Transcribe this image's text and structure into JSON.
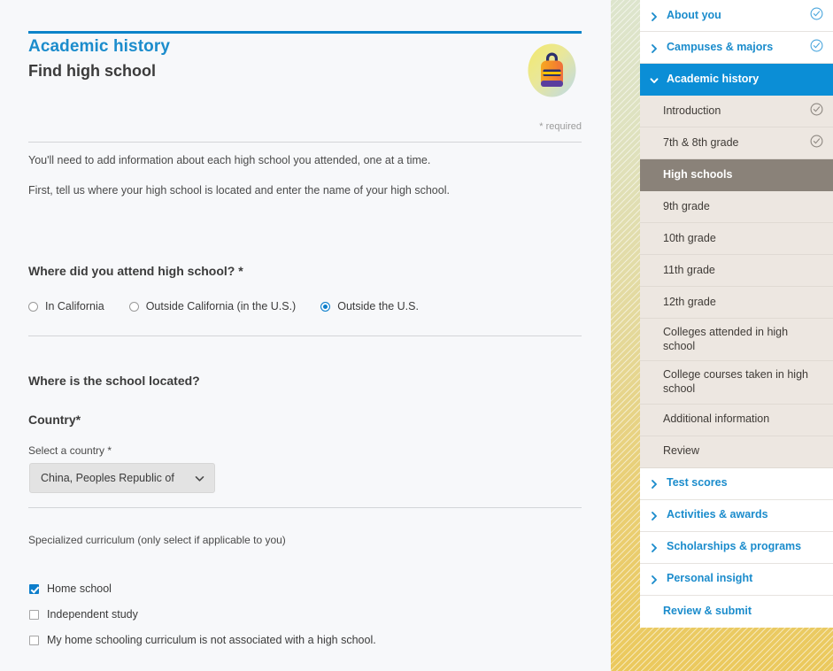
{
  "theme": {
    "accent_blue": "#0b83c9",
    "nav_active_blue": "#0b8ed6",
    "current_row_grey": "#8a8279",
    "sub_row_beige": "#ede7e1",
    "page_bg": "#f7f8fa",
    "backdrop_top": "#dde5cd",
    "backdrop_bottom": "#ebc95d"
  },
  "header": {
    "eyebrow": "Academic history",
    "title": "Find high school",
    "icon": "backpack-icon",
    "required_note": "* required"
  },
  "intro": {
    "paragraph_1": "You'll need to add information about each high school you attended, one at a time.",
    "paragraph_2": "First, tell us where your high school is located and enter the name of your high school."
  },
  "location_question": {
    "label": "Where did you attend high school? *",
    "options": [
      {
        "label": "In California",
        "selected": false
      },
      {
        "label": "Outside California (in the U.S.)",
        "selected": false
      },
      {
        "label": "Outside the U.S.",
        "selected": true
      }
    ]
  },
  "school_location": {
    "heading": "Where is the school located?",
    "country_heading": "Country*",
    "select_label": "Select a country *",
    "select_value": "China, Peoples Republic of",
    "select_icon": "chevron-down-icon"
  },
  "specialized_curriculum": {
    "hint": "Specialized curriculum (only select if applicable to you)",
    "options": [
      {
        "label": "Home school",
        "checked": true
      },
      {
        "label": "Independent study",
        "checked": false
      },
      {
        "label": "My home schooling curriculum is not associated with a high school.",
        "checked": false
      }
    ]
  },
  "sidebar": {
    "items": [
      {
        "label": "About you",
        "type": "top",
        "caret": "chevron-right-icon",
        "status": "check-circle-blue-icon"
      },
      {
        "label": "Campuses & majors",
        "type": "top",
        "caret": "chevron-right-icon",
        "status": "check-circle-blue-icon"
      },
      {
        "label": "Academic history",
        "type": "active-group",
        "caret": "chevron-down-icon",
        "status": ""
      },
      {
        "label": "Introduction",
        "type": "sub",
        "caret": "",
        "status": "check-circle-grey-icon"
      },
      {
        "label": "7th & 8th grade",
        "type": "sub",
        "caret": "",
        "status": "check-circle-grey-icon"
      },
      {
        "label": "High schools",
        "type": "sub-current",
        "caret": "",
        "status": ""
      },
      {
        "label": "9th grade",
        "type": "sub",
        "caret": "",
        "status": ""
      },
      {
        "label": "10th grade",
        "type": "sub",
        "caret": "",
        "status": ""
      },
      {
        "label": "11th grade",
        "type": "sub",
        "caret": "",
        "status": ""
      },
      {
        "label": "12th grade",
        "type": "sub",
        "caret": "",
        "status": ""
      },
      {
        "label": "Colleges attended in high school",
        "type": "sub",
        "caret": "",
        "status": ""
      },
      {
        "label": "College courses taken in high school",
        "type": "sub",
        "caret": "",
        "status": ""
      },
      {
        "label": "Additional information",
        "type": "sub",
        "caret": "",
        "status": ""
      },
      {
        "label": "Review",
        "type": "sub",
        "caret": "",
        "status": ""
      },
      {
        "label": "Test scores",
        "type": "top",
        "caret": "chevron-right-icon",
        "status": ""
      },
      {
        "label": "Activities & awards",
        "type": "top",
        "caret": "chevron-right-icon",
        "status": ""
      },
      {
        "label": "Scholarships & programs",
        "type": "top",
        "caret": "chevron-right-icon",
        "status": ""
      },
      {
        "label": "Personal insight",
        "type": "top",
        "caret": "chevron-right-icon",
        "status": ""
      },
      {
        "label": "Review & submit",
        "type": "plain",
        "caret": "",
        "status": ""
      }
    ]
  }
}
